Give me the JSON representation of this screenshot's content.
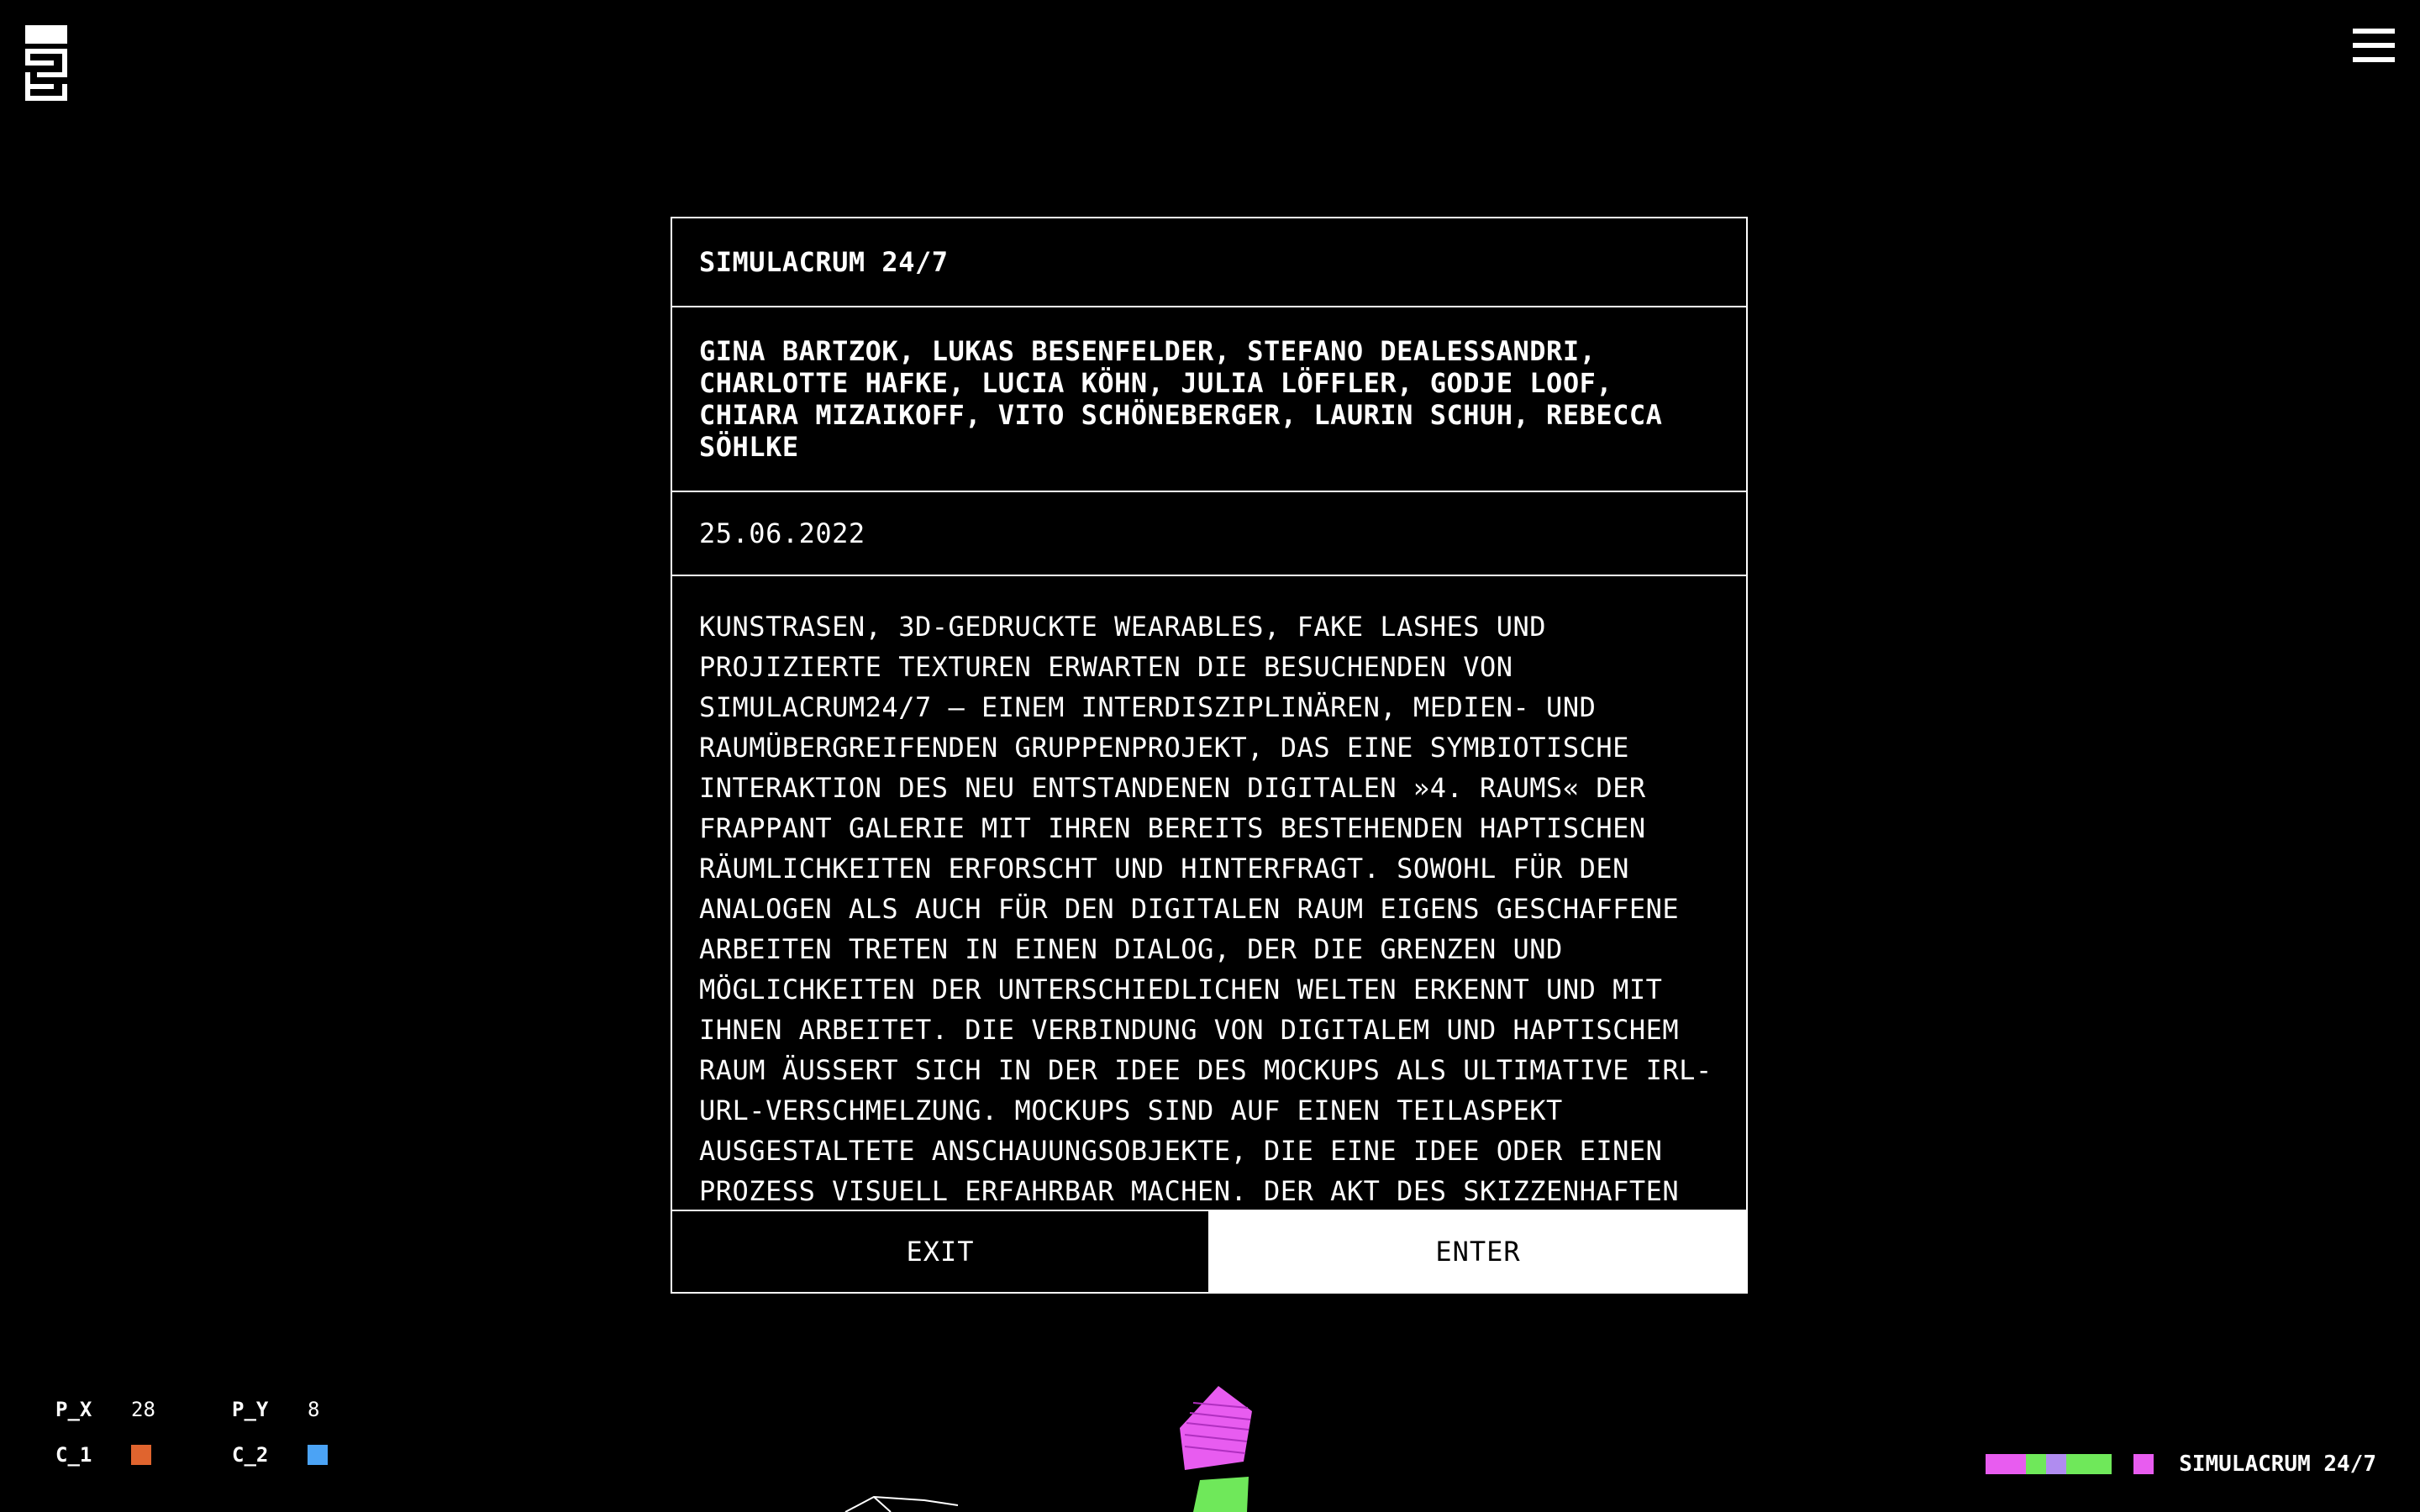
{
  "header": {
    "logo_icon": "labyrinth-logo-icon",
    "menu_icon": "hamburger-menu-icon"
  },
  "panel": {
    "title": "SIMULACRUM 24/7",
    "artists": "GINA BARTZOK, LUKAS BESENFELDER, STEFANO DEALESSANDRI, CHARLOTTE HAFKE, LUCIA KÖHN, JULIA LÖFFLER, GODJE LOOF, CHIARA MIZAIKOFF, VITO SCHÖNEBERGER, LAURIN SCHUH, REBECCA SÖHLKE",
    "date": "25.06.2022",
    "description": "KUNSTRASEN, 3D-GEDRUCKTE WEARABLES, FAKE LASHES UND PROJIZIERTE TEXTUREN ERWARTEN DIE BESUCHENDEN VON SIMULACRUM24/7 – EINEM INTERDISZIPLINÄREN, MEDIEN- UND RAUMÜBERGREIFENDEN GRUPPENPROJEKT, DAS EINE SYMBIOTISCHE INTERAKTION DES NEU ENTSTANDENEN DIGITALEN »4. RAUMS« DER FRAPPANT GALERIE MIT IHREN BEREITS BESTEHENDEN HAPTISCHEN RÄUMLICHKEITEN ERFORSCHT UND HINTERFRAGT. SOWOHL FÜR DEN ANALOGEN ALS AUCH FÜR DEN DIGITALEN RAUM EIGENS GESCHAFFENE ARBEITEN TRETEN IN EINEN DIALOG, DER DIE GRENZEN UND MÖGLICHKEITEN DER UNTERSCHIEDLICHEN WELTEN ERKENNT UND MIT IHNEN ARBEITET. DIE VERBINDUNG VON DIGITALEM UND HAPTISCHEM RAUM ÄUSSERT SICH IN DER IDEE DES MOCKUPS ALS ULTIMATIVE IRL-URL-VERSCHMELZUNG. MOCKUPS SIND AUF EINEN TEILASPEKT AUSGESTALTETE ANSCHAUUNGSOBJEKTE, DIE EINE IDEE ODER EINEN PROZESS VISUELL ERFAHRBAR MACHEN. DER AKT DES SKIZZENHAFTEN",
    "exit_label": "EXIT",
    "enter_label": "ENTER"
  },
  "readouts": {
    "px_label": "P_X",
    "px_value": "28",
    "py_label": "P_Y",
    "py_value": "8",
    "c1_label": "C_1",
    "c1_color": "#e0642e",
    "c2_label": "C_2",
    "c2_color": "#4ba3f5"
  },
  "status": {
    "label": "SIMULACRUM 24/7",
    "bar_colors": [
      "#e85cf0",
      "#e85cf0",
      "#6fe85a",
      "#b08cf0",
      "#6fe85a",
      "#6fe85a"
    ],
    "marker_color": "#e85cf0"
  }
}
